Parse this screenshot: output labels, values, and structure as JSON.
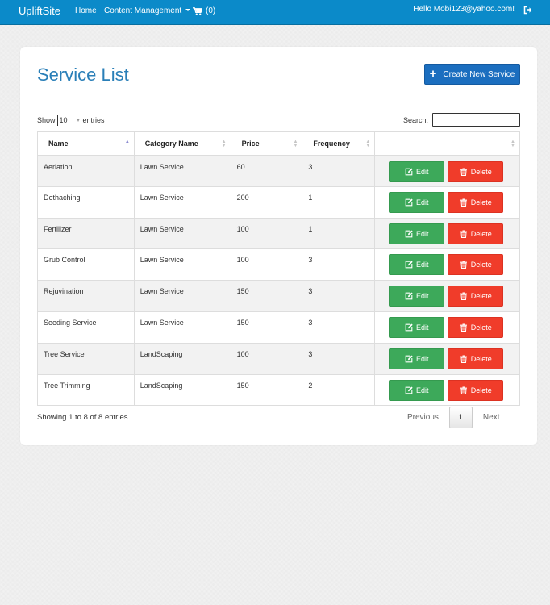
{
  "navbar": {
    "brand": "UpliftSite",
    "home": "Home",
    "content_management": "Content Management",
    "cart_count": "(0)",
    "hello": "Hello Mobi123@yahoo.com!"
  },
  "page": {
    "title": "Service List",
    "create_button": "Create New Service"
  },
  "table_controls": {
    "show_label": "Show",
    "length_value": "10",
    "entries_label": "entries",
    "search_label": "Search:",
    "search_value": ""
  },
  "table": {
    "columns": [
      "Name",
      "Category Name",
      "Price",
      "Frequency"
    ],
    "edit_label": "Edit",
    "delete_label": "Delete",
    "rows": [
      {
        "name": "Aeriation",
        "category": "Lawn Service",
        "price": "60",
        "frequency": "3"
      },
      {
        "name": "Dethaching",
        "category": "Lawn Service",
        "price": "200",
        "frequency": "1"
      },
      {
        "name": "Fertilizer",
        "category": "Lawn Service",
        "price": "100",
        "frequency": "1"
      },
      {
        "name": "Grub Control",
        "category": "Lawn Service",
        "price": "100",
        "frequency": "3"
      },
      {
        "name": "Rejuvination",
        "category": "Lawn Service",
        "price": "150",
        "frequency": "3"
      },
      {
        "name": "Seeding Service",
        "category": "Lawn Service",
        "price": "150",
        "frequency": "3"
      },
      {
        "name": "Tree Service",
        "category": "LandScaping",
        "price": "100",
        "frequency": "3"
      },
      {
        "name": "Tree Trimming",
        "category": "LandScaping",
        "price": "150",
        "frequency": "2"
      }
    ]
  },
  "footer": {
    "info": "Showing 1 to 8 of 8 entries",
    "previous": "Previous",
    "current_page": "1",
    "next": "Next"
  },
  "colors": {
    "navbar": "#0b8ac9",
    "primary": "#1b6ebf",
    "edit": "#3da95a",
    "delete": "#f03c2a"
  },
  "icons": [
    "cart-icon",
    "logout-icon",
    "plus-icon",
    "edit-icon",
    "trash-icon"
  ]
}
